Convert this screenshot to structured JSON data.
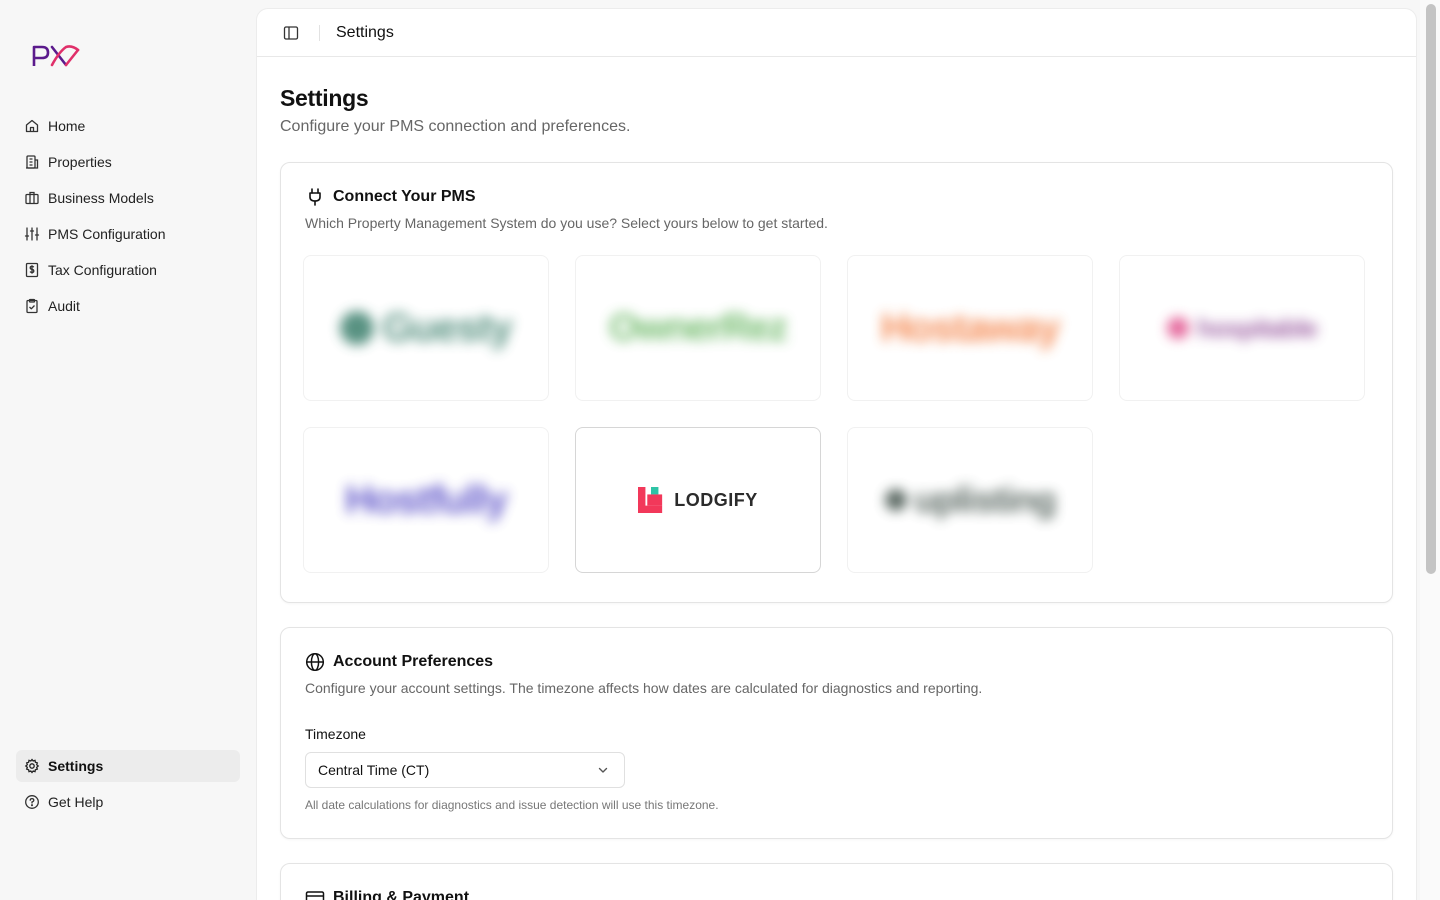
{
  "app": {
    "logo_label": "PX"
  },
  "sidebar": {
    "items": [
      {
        "label": "Home",
        "icon": "home-icon"
      },
      {
        "label": "Properties",
        "icon": "building-icon"
      },
      {
        "label": "Business Models",
        "icon": "briefcase-icon"
      },
      {
        "label": "PMS Configuration",
        "icon": "sliders-icon"
      },
      {
        "label": "Tax Configuration",
        "icon": "dollar-receipt-icon"
      },
      {
        "label": "Audit",
        "icon": "clipboard-check-icon"
      }
    ],
    "bottom_items": [
      {
        "label": "Settings",
        "icon": "gear-icon",
        "active": true
      },
      {
        "label": "Get Help",
        "icon": "help-circle-icon"
      }
    ]
  },
  "topbar": {
    "breadcrumb": "Settings"
  },
  "page": {
    "title": "Settings",
    "subtitle": "Configure your PMS connection and preferences."
  },
  "pms_card": {
    "title": "Connect Your PMS",
    "description": "Which Property Management System do you use? Select yours below to get started.",
    "options": [
      {
        "name": "Guesty",
        "selected": false,
        "color": "#3b7f6c"
      },
      {
        "name": "OwnerRez",
        "selected": false,
        "color": "#5ab054"
      },
      {
        "name": "Hostaway",
        "selected": false,
        "color": "#f37b3d"
      },
      {
        "name": "hospitable",
        "selected": false,
        "color": "#8f4a96"
      },
      {
        "name": "Hostfully",
        "selected": false,
        "color": "#4a3fc2"
      },
      {
        "name": "LODGIFY",
        "selected": true,
        "color": "#f2385a"
      },
      {
        "name": "uplisting",
        "selected": false,
        "color": "#3f4f48"
      }
    ]
  },
  "preferences_card": {
    "title": "Account Preferences",
    "description": "Configure your account settings. The timezone affects how dates are calculated for diagnostics and reporting.",
    "timezone_label": "Timezone",
    "timezone_value": "Central Time (CT)",
    "timezone_hint": "All date calculations for diagnostics and issue detection will use this timezone."
  },
  "billing_card": {
    "title": "Billing & Payment"
  },
  "colors": {
    "accent_purple": "#5b1a8c",
    "accent_pink": "#e0306a"
  }
}
